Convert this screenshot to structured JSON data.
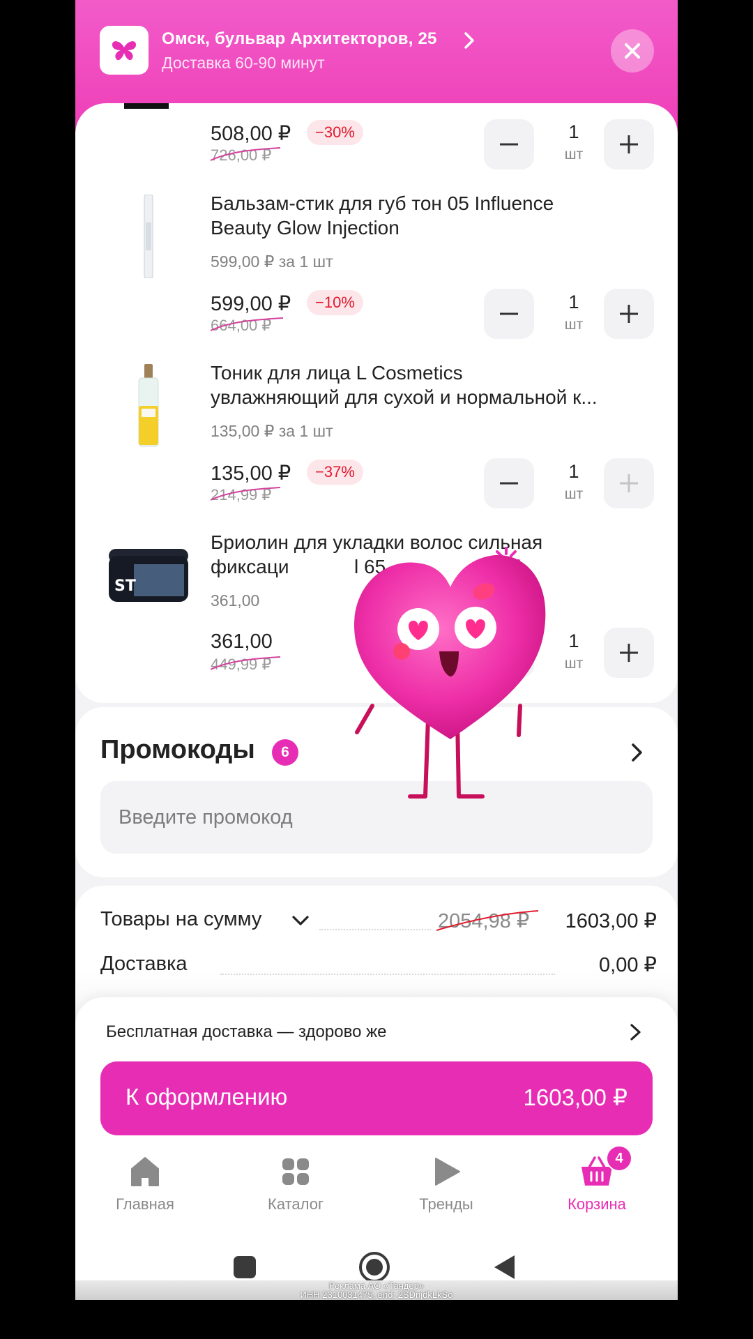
{
  "header": {
    "address": "Омск, бульвар Архитекторов, 25",
    "delivery_time": "Доставка 60-90 минут",
    "colors": {
      "gradient_top": "#f25bc9",
      "gradient_bottom": "#ee3fb8"
    }
  },
  "cart": {
    "items": [
      {
        "title": "",
        "unit_price": "",
        "price": "508,00 ₽",
        "old_price": "726,00 ₽",
        "discount": "−30%",
        "qty": "1",
        "unit": "шт",
        "plus_enabled": true
      },
      {
        "title": "Бальзам-стик для губ тон 05 Influence Beauty Glow Injection",
        "title_line1": "Бальзам-стик для губ тон 05 Influence",
        "title_line2": "Beauty Glow Injection",
        "unit_price": "599,00 ₽ за 1 шт",
        "price": "599,00 ₽",
        "old_price": "664,00 ₽",
        "discount": "−10%",
        "qty": "1",
        "unit": "шт",
        "plus_enabled": true
      },
      {
        "title": "Тоник для лица L Cosmetics увлажняющий для сухой и нормальной к...",
        "title_line1": "Тоник для лица L Cosmetics",
        "title_line2": "увлажняющий для сухой и нормальной к...",
        "unit_price": "135,00 ₽ за 1 шт",
        "price": "135,00 ₽",
        "old_price": "214,99 ₽",
        "discount": "−37%",
        "qty": "1",
        "unit": "шт",
        "plus_enabled": false
      },
      {
        "title": "Бриолин для укладки волос сильная фиксация",
        "title_line1": "Бриолин для укладки волос сильная",
        "title_line2": "фиксаци",
        "title_line2_tail": "l 65",
        "unit_price": "361,00",
        "price": "361,00",
        "old_price": "449,99 ₽",
        "qty": "1",
        "unit": "шт",
        "plus_enabled": true
      }
    ]
  },
  "promo": {
    "title": "Промокоды",
    "count": "6",
    "placeholder": "Введите промокод"
  },
  "summary": {
    "goods_label": "Товары на сумму",
    "goods_old": "2054,98 ₽",
    "goods_total": "1603,00 ₽",
    "delivery_label": "Доставка",
    "delivery_value": "0,00 ₽"
  },
  "checkout": {
    "free_delivery_text": "Бесплатная доставка — здорово же",
    "button_label": "К оформлению",
    "button_amount": "1603,00 ₽",
    "accent": "#e82db5"
  },
  "tabbar": {
    "tabs": [
      {
        "label": "Главная",
        "icon": "home-icon"
      },
      {
        "label": "Каталог",
        "icon": "catalog-icon"
      },
      {
        "label": "Тренды",
        "icon": "play-icon"
      },
      {
        "label": "Корзина",
        "icon": "basket-icon",
        "badge": "4",
        "active": true
      }
    ]
  },
  "ad": {
    "line1": "Реклама АО «Тандер»",
    "line2": "ИНН 2310031475, erid: 2SDnjdkLkSo"
  }
}
